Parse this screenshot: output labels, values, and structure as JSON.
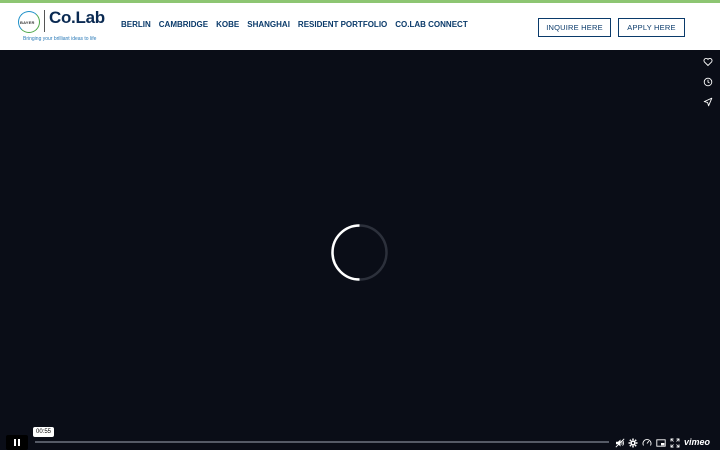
{
  "header": {
    "brand_name": "Co.Lab",
    "bayer_text": "BAYER",
    "tagline": "Bringing your brilliant ideas to life",
    "nav": [
      "BERLIN",
      "CAMBRIDGE",
      "KOBE",
      "SHANGHAI",
      "RESIDENT PORTFOLIO",
      "CO.LAB CONNECT"
    ],
    "inquire_label": "INQUIRE HERE",
    "apply_label": "APPLY HERE",
    "accent_color": "#8dc572",
    "nav_color": "#0a3a6a"
  },
  "player": {
    "side_actions": [
      "heart-icon",
      "clock-icon",
      "send-icon"
    ],
    "state": "loading",
    "current_time": "00:55",
    "progress_fraction": 0.0,
    "controls": [
      "volume-muted-icon",
      "settings-gear-icon",
      "speed-icon",
      "picture-in-picture-icon",
      "fullscreen-icon"
    ],
    "provider": "vimeo"
  }
}
